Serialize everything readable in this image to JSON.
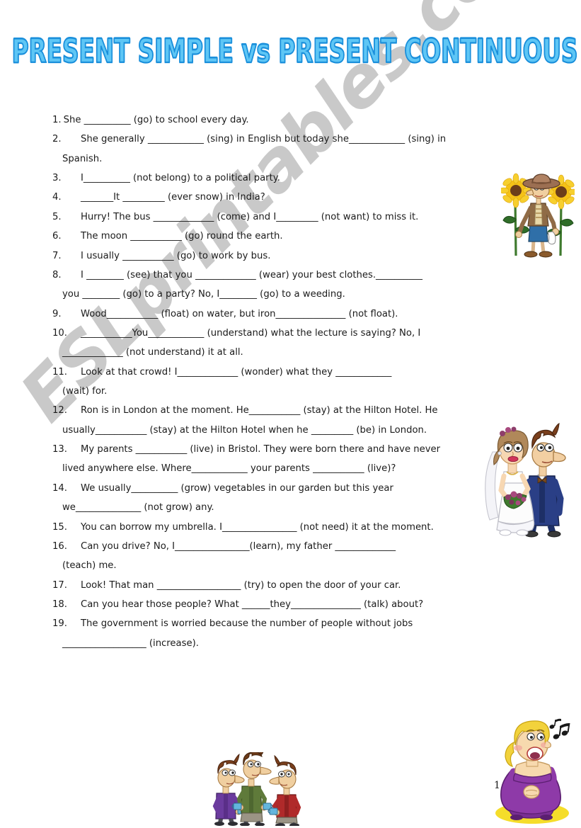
{
  "title": "PRESENT SIMPLE vs PRESENT CONTINUOUS",
  "title_color": "#5ec6f5",
  "title_outline_color": "#1a8fdb",
  "watermark": "ESLprintables.com",
  "watermark_color": "#c9c9c9",
  "page_number": "1",
  "exercises": [
    {
      "number": "1.",
      "indent": "tight",
      "lines": [
        "She __________ (go) to school every day."
      ]
    },
    {
      "number": "2.",
      "indent": "tabbed",
      "lines": [
        "She generally ____________ (sing) in English but today she____________ (sing) in",
        "Spanish."
      ]
    },
    {
      "number": "3.",
      "indent": "tabbed",
      "lines": [
        "I__________ (not belong) to a political party."
      ]
    },
    {
      "number": "4.",
      "indent": "tabbed",
      "lines": [
        "_______It _________ (ever snow) in India?"
      ]
    },
    {
      "number": "5.",
      "indent": "tabbed",
      "lines": [
        "Hurry! The bus _____________ (come) and I_________ (not want) to miss it."
      ]
    },
    {
      "number": "6.",
      "indent": "tabbed",
      "lines": [
        "The moon ___________ (go) round the earth."
      ]
    },
    {
      "number": "7.",
      "indent": "tabbed",
      "lines": [
        "I usually ___________ (go) to work by bus."
      ]
    },
    {
      "number": "8.",
      "indent": "tabbed",
      "lines": [
        "I ________ (see) that you _____________ (wear) your best clothes.__________",
        "you ________ (go) to a party? No, I________ (go) to a weeding."
      ]
    },
    {
      "number": "9.",
      "indent": "tabbed",
      "lines": [
        "Wood___________ (float) on water, but iron_______________ (not float)."
      ]
    },
    {
      "number": "10.",
      "indent": "tabbed",
      "lines": [
        "___________You____________ (understand) what the lecture is saying? No, I",
        "_____________ (not understand) it at all."
      ]
    },
    {
      "number": "11.",
      "indent": "tabbed",
      "lines": [
        "Look at that crowd! I_____________ (wonder) what they ____________",
        "(wait) for."
      ]
    },
    {
      "number": "12.",
      "indent": "tabbed",
      "lines": [
        "Ron is in London at the moment. He___________ (stay) at the Hilton Hotel. He",
        "usually___________ (stay) at the Hilton Hotel when he _________ (be) in London."
      ]
    },
    {
      "number": "13.",
      "indent": "tabbed",
      "lines": [
        "My parents ___________ (live) in Bristol. They were born there and have never",
        "lived anywhere else. Where____________ your parents ___________ (live)?"
      ]
    },
    {
      "number": "14.",
      "indent": "tabbed",
      "lines": [
        "We usually__________ (grow) vegetables in our garden but this year",
        "we______________ (not grow) any."
      ]
    },
    {
      "number": "15.",
      "indent": "tabbed",
      "lines": [
        "You can borrow my umbrella. I________________ (not need) it at the moment."
      ]
    },
    {
      "number": "16.",
      "indent": "tabbed",
      "lines": [
        "Can you drive? No, I________________(learn), my father _____________",
        "(teach) me."
      ]
    },
    {
      "number": "17.",
      "indent": "tabbed",
      "lines": [
        "Look! That man __________________ (try) to open the door of your car."
      ]
    },
    {
      "number": "18.",
      "indent": "tabbed",
      "lines": [
        "Can you hear those people? What ______they_______________ (talk) about?"
      ]
    },
    {
      "number": "19.",
      "indent": "tabbed",
      "lines": [
        "The government is worried because the number of people without jobs",
        "__________________ (increase)."
      ]
    }
  ],
  "clipart": [
    {
      "name": "gardener-with-sunflowers-image",
      "alt": "Gardener in a wide brown hat standing between two tall sunflowers"
    },
    {
      "name": "wedding-couple-image",
      "alt": "Bride in a white dress with veil and bouquet beside a groom in a blue suit"
    },
    {
      "name": "three-men-with-cups-image",
      "alt": "Three cartoon men holding blue cups and talking"
    },
    {
      "name": "singing-woman-image",
      "alt": "Blonde woman in a purple dress singing with music notes"
    }
  ]
}
